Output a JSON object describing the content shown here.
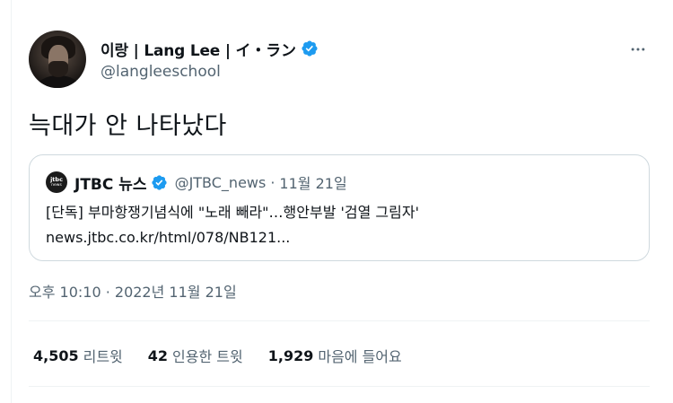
{
  "tweet": {
    "author": {
      "display_name": "이랑 | Lang Lee | イ・ラン",
      "handle": "@langleeschool",
      "verified": true
    },
    "text": "늑대가 안 나타났다",
    "timestamp": "오후 10:10 · 2022년 11월 21일",
    "quote": {
      "logo_text": "jtbc",
      "logo_sub": "news",
      "name": "JTBC 뉴스",
      "handle": "@JTBC_news",
      "separator": "·",
      "date": "11월 21일",
      "headline": "[단독] 부마항쟁기념식에 \"노래 빼라\"…행안부발 '검열 그림자'",
      "link": "news.jtbc.co.kr/html/078/NB121..."
    },
    "stats": [
      {
        "count": "4,505",
        "label": "리트윗"
      },
      {
        "count": "42",
        "label": "인용한 트윗"
      },
      {
        "count": "1,929",
        "label": "마음에 들어요"
      }
    ]
  },
  "icons": {
    "verified": "verified-badge-icon",
    "more": "more-horizontal-icon"
  },
  "colors": {
    "verified_blue": "#1d9bf0",
    "secondary_text": "#536471",
    "border": "#cfd9de"
  }
}
